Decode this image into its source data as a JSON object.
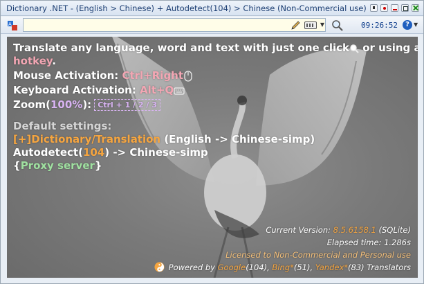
{
  "window": {
    "title": "Dictionary .NET - (English > Chinese) + Autodetect(104) > Chinese (Non-Commercial use)"
  },
  "toolbar": {
    "search_value": "",
    "search_placeholder": "",
    "clock": "09:26:52",
    "help_label": "?"
  },
  "main": {
    "intro_prefix": "Translate any language, word and text with just one click",
    "intro_suffix": " or using a",
    "hotkey_link": "hotkey",
    "period": ".",
    "mouse_label": "Mouse Activation: ",
    "mouse_value": "Ctrl+Right",
    "keyboard_label": "Keyboard Activation: ",
    "keyboard_value": "Alt+Q",
    "zoom_label": "Zoom(",
    "zoom_value": "100%",
    "zoom_close": "):",
    "zoom_keys": "Ctrl + 1 / 2 / 3",
    "default_settings": "Default settings:",
    "dictionary_link": "[+]Dictionary/Translation",
    "dictionary_pair": " (English -> Chinese-simp)",
    "autodetect_prefix": "Autodetect(",
    "autodetect_count": "104",
    "autodetect_suffix": ") -> Chinese-simp",
    "proxy_open": "{",
    "proxy_link": "Proxy server",
    "proxy_close": "}"
  },
  "info": {
    "version_label": "Current Version: ",
    "version_value": "8.5.6158.1",
    "version_db": " (SQLite)",
    "elapsed": "Elapsed time: 1.286s",
    "license": "Licensed to Non-Commercial and Personal use",
    "powered_prefix": "Powered by ",
    "google": "Google",
    "google_count": "(104), ",
    "bing": "Bing*",
    "bing_count": "(51), ",
    "yandex": "Yandex*",
    "yandex_count": "(83) Translators"
  },
  "colors": {
    "accent_orange": "#f5a540",
    "accent_pink": "#f2a6b3",
    "accent_green": "#9fe0a0",
    "accent_purple": "#d8b3f2"
  },
  "icons": [
    "app-icon",
    "pencil-icon",
    "keyboard-icon",
    "magnifier-icon",
    "help-icon",
    "mouse-icon",
    "keyboard-small-icon",
    "yinyang-icon"
  ]
}
